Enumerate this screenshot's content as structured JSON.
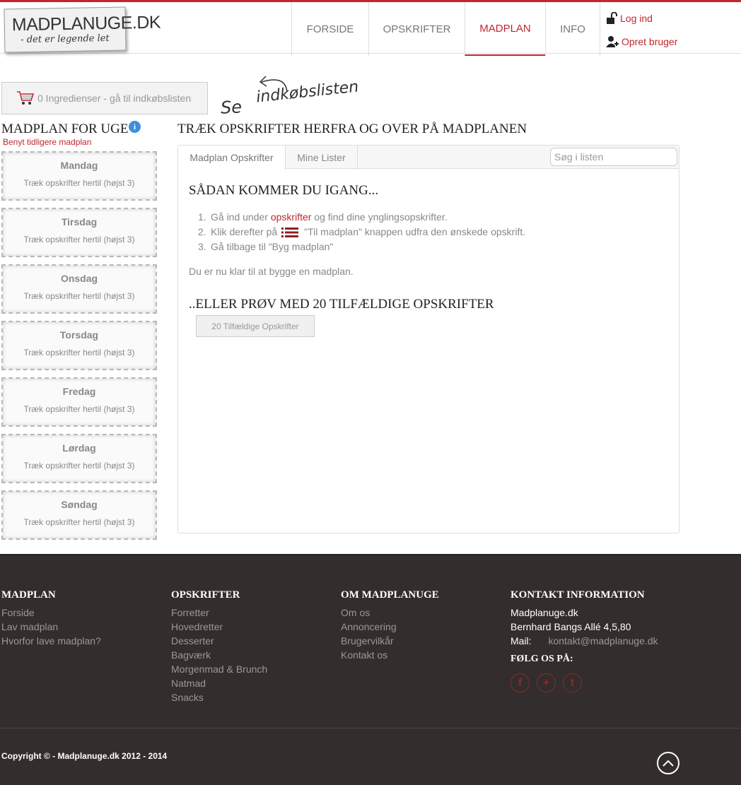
{
  "logo": {
    "name": "MADPLANUGE.DK",
    "tagline": "- det er legende let"
  },
  "nav": {
    "items": [
      "FORSIDE",
      "OPSKRIFTER",
      "MADPLAN",
      "INFO"
    ],
    "active": "MADPLAN"
  },
  "user": {
    "login": "Log ind",
    "register": "Opret bruger"
  },
  "cart": {
    "label": "0 Ingredienser - gå til indkøbslisten"
  },
  "annotation": {
    "word1": "Se",
    "word2": "indkøbslisten"
  },
  "sidebar": {
    "title": "MADPLAN FOR UGE",
    "info_glyph": "i",
    "subtitle": "Benyt tidligere madplan",
    "days": [
      {
        "name": "Mandag",
        "hint": "Træk opskrifter hertil (højst 3)"
      },
      {
        "name": "Tirsdag",
        "hint": "Træk opskrifter hertil (højst 3)"
      },
      {
        "name": "Onsdag",
        "hint": "Træk opskrifter hertil (højst 3)"
      },
      {
        "name": "Torsdag",
        "hint": "Træk opskrifter hertil (højst 3)"
      },
      {
        "name": "Fredag",
        "hint": "Træk opskrifter hertil (højst 3)"
      },
      {
        "name": "Lørdag",
        "hint": "Træk opskrifter hertil (højst 3)"
      },
      {
        "name": "Søndag",
        "hint": "Træk opskrifter hertil (højst 3)"
      }
    ]
  },
  "main": {
    "title": "TRÆK OPSKRIFTER HERFRA OG OVER PÅ MADPLANEN",
    "tabs": [
      "Madplan Opskrifter",
      "Mine Lister"
    ],
    "search_placeholder": "Søg i listen",
    "getting_started": "SÅDAN KOMMER DU IGANG...",
    "steps": {
      "n1": "1.",
      "s1a": "Gå ind under ",
      "s1link": "opskrifter",
      "s1b": " og find dine ynglingsopskrifter.",
      "n2": "2.",
      "s2a": "Klik derefter på",
      "s2b": "\"Til madplan\" knappen udfra den ønskede opskrift.",
      "n3": "3.",
      "s3": "Gå tilbage til \"Byg madplan\""
    },
    "ready": "Du er nu klar til at bygge en madplan.",
    "random_title": "..ELLER PRØV MED 20 TILFÆLDIGE OPSKRIFTER",
    "random_button": "20 Tilfældige Opskrifter"
  },
  "footer": {
    "madplan": {
      "title": "MADPLAN",
      "links": [
        "Forside",
        "Lav madplan",
        "Hvorfor lave madplan?"
      ]
    },
    "opskrifter": {
      "title": "OPSKRIFTER",
      "links": [
        "Forretter",
        "Hovedretter",
        "Desserter",
        "Bagværk",
        "Morgenmad & Brunch",
        "Natmad",
        "Snacks"
      ]
    },
    "om": {
      "title": "OM MADPLANUGE",
      "links": [
        "Om os",
        "Annoncering",
        "Brugervilkår",
        "Kontakt os"
      ]
    },
    "kontakt": {
      "title": "KONTAKT INFORMATION",
      "name": "Madplanuge.dk",
      "address": "Bernhard Bangs Allé 4,5,80",
      "mail_label": "Mail:",
      "mail": "kontakt@madplanuge.dk",
      "follow": "FØLG OS PÅ:",
      "socials": [
        "f",
        "+",
        "t"
      ]
    },
    "copyright": "Copyright © - Madplanuge.dk 2012 - 2014"
  },
  "colors": {
    "accent": "#c0272d",
    "footer_bg": "#332d2d"
  }
}
